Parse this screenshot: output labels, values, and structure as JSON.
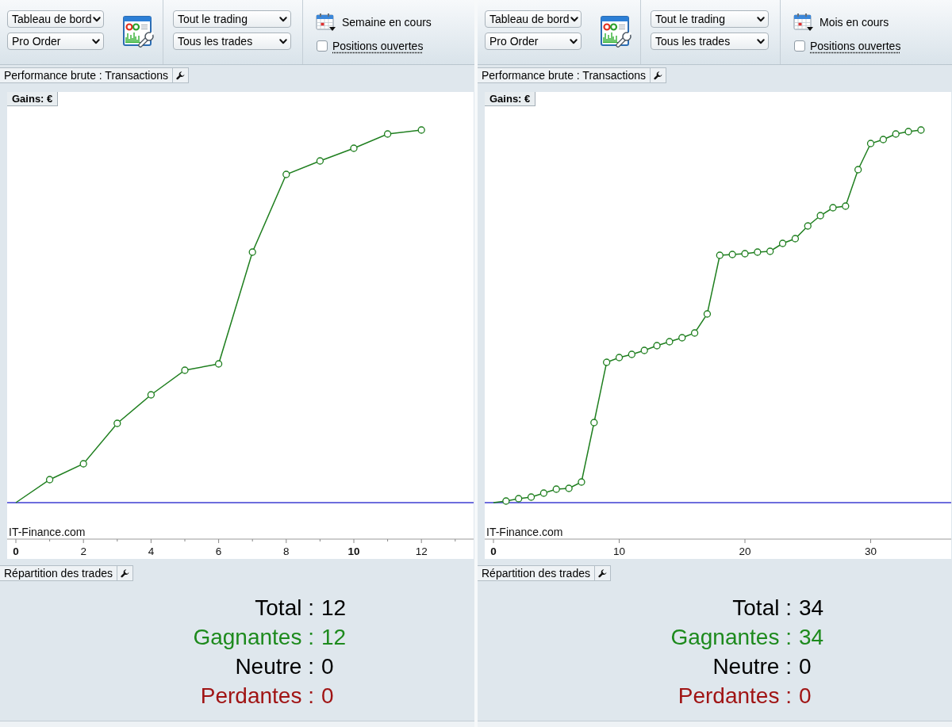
{
  "panels": [
    {
      "toolbar": {
        "view_select": "Tableau de bord",
        "platform_select": "Pro Order",
        "scope_select": "Tout le trading",
        "trades_select": "Tous les trades",
        "period": "Semaine en cours",
        "open_positions": {
          "label": "Positions ouvertes",
          "checked": false
        }
      },
      "performance": {
        "title": "Performance brute : Transactions",
        "chart": {
          "axis_title": "Gains: €",
          "brand": "IT-Finance.com",
          "x_tick_labels": [
            {
              "label": "0",
              "highlighted": true
            },
            {
              "label": "2",
              "highlighted": false
            },
            {
              "label": "4",
              "highlighted": false
            },
            {
              "label": "6",
              "highlighted": false
            },
            {
              "label": "8",
              "highlighted": false
            },
            {
              "label": "10",
              "highlighted": true
            },
            {
              "label": "12",
              "highlighted": false
            }
          ]
        }
      },
      "distribution": {
        "title": "Répartition des trades",
        "stats": [
          {
            "label": "Total :",
            "value": "12",
            "color": "#000000"
          },
          {
            "label": "Gagnantes :",
            "value": "12",
            "color": "#1d8a1d"
          },
          {
            "label": "Neutre :",
            "value": "0",
            "color": "#000000"
          },
          {
            "label": "Perdantes :",
            "value": "0",
            "color": "#a01414"
          }
        ]
      }
    },
    {
      "toolbar": {
        "view_select": "Tableau de bord",
        "platform_select": "Pro Order",
        "scope_select": "Tout le trading",
        "trades_select": "Tous les trades",
        "period": "Mois en cours",
        "open_positions": {
          "label": "Positions ouvertes",
          "checked": false
        }
      },
      "performance": {
        "title": "Performance brute : Transactions",
        "chart": {
          "axis_title": "Gains: €",
          "brand": "IT-Finance.com",
          "x_tick_labels": [
            {
              "label": "0",
              "highlighted": true
            },
            {
              "label": "10",
              "highlighted": false
            },
            {
              "label": "20",
              "highlighted": false
            },
            {
              "label": "30",
              "highlighted": false
            }
          ]
        }
      },
      "distribution": {
        "title": "Répartition des trades",
        "stats": [
          {
            "label": "Total :",
            "value": "34",
            "color": "#000000"
          },
          {
            "label": "Gagnantes :",
            "value": "34",
            "color": "#1d8a1d"
          },
          {
            "label": "Neutre :",
            "value": "0",
            "color": "#000000"
          },
          {
            "label": "Perdantes :",
            "value": "0",
            "color": "#a01414"
          }
        ]
      }
    }
  ]
}
